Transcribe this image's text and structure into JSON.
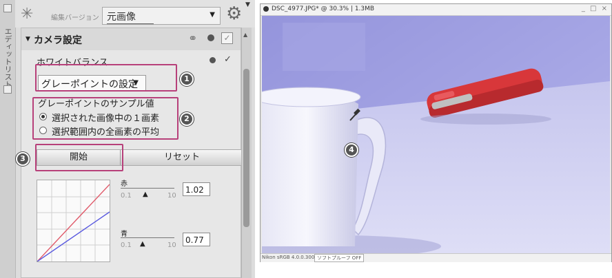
{
  "left_panel": {
    "side_tab_label": "エディットリスト",
    "version_label": "編集バージョン",
    "version_value": "元画像",
    "section_title": "カメラ設定",
    "white_balance_label": "ホワイトバランス",
    "gray_point_select": "グレーポイントの設定",
    "sample_value_label": "グレーポイントのサンプル値",
    "radio_options": [
      "選択された画像中の１画素",
      "選択範囲内の全画素の平均"
    ],
    "start_button": "開始",
    "reset_button": "リセット",
    "red_channel": {
      "label": "赤",
      "min": "0.1",
      "max": "10",
      "value": "1.02"
    },
    "blue_channel": {
      "label": "青",
      "min": "0.1",
      "max": "10",
      "value": "0.77"
    },
    "callouts": [
      "1",
      "2",
      "3"
    ]
  },
  "right_panel": {
    "window_title": "DSC_4977.JPG* @ 30.3% | 1.3MB",
    "window_controls": "_ □ ×",
    "status_profile": "Nikon sRGB 4.0.0.3002",
    "status_proof": "ソフトプルーフ OFF",
    "callout": "4"
  },
  "colors": {
    "highlight": "#b7407a",
    "red_curve": "#e05a6a",
    "blue_curve": "#5a5ae0",
    "stapler": "#d8373a"
  }
}
